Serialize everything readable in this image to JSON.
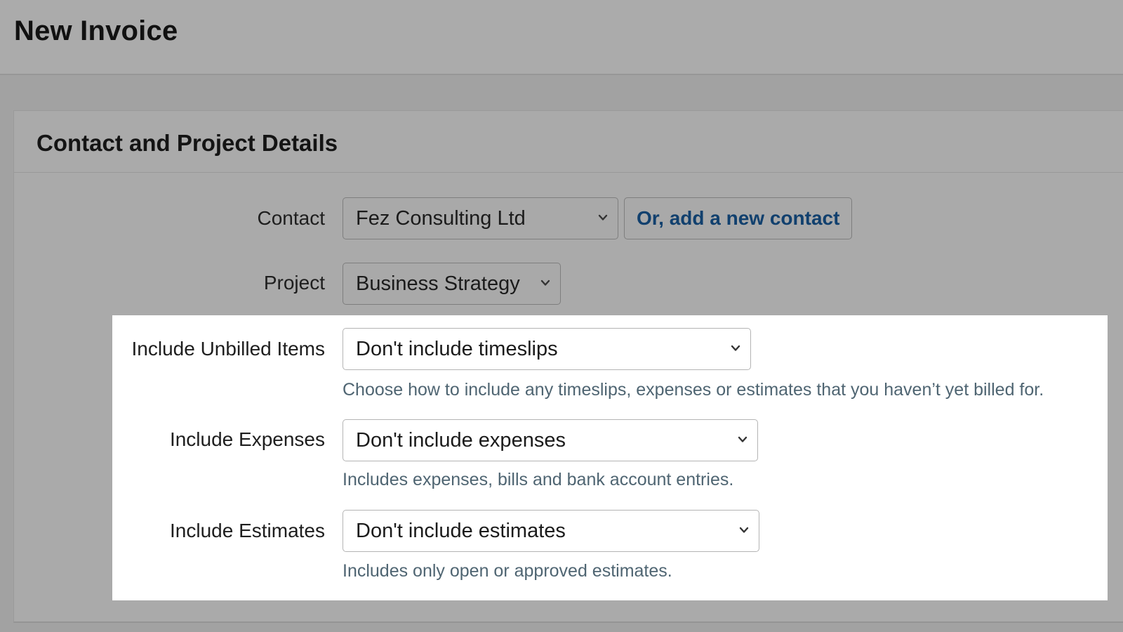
{
  "page": {
    "title": "New Invoice"
  },
  "panel": {
    "title": "Contact and Project Details"
  },
  "contact": {
    "label": "Contact",
    "value": "Fez Consulting Ltd",
    "add_link": "Or, add a new contact"
  },
  "project": {
    "label": "Project",
    "value": "Business Strategy"
  },
  "unbilled": {
    "label": "Include Unbilled Items",
    "value": "Don't include timeslips",
    "hint": "Choose how to include any timeslips, expenses or estimates that you haven’t yet billed for."
  },
  "expenses": {
    "label": "Include Expenses",
    "value": "Don't include expenses",
    "hint": "Includes expenses, bills and bank account entries."
  },
  "estimates": {
    "label": "Include Estimates",
    "value": "Don't include estimates",
    "hint": "Includes only open or approved estimates."
  },
  "icons": {
    "dropdown": "chevron-down-icon"
  },
  "colors": {
    "link": "#11406e",
    "hint": "#4f6572",
    "overlay": "#a2a2a2",
    "highlight": "#ffffff"
  }
}
